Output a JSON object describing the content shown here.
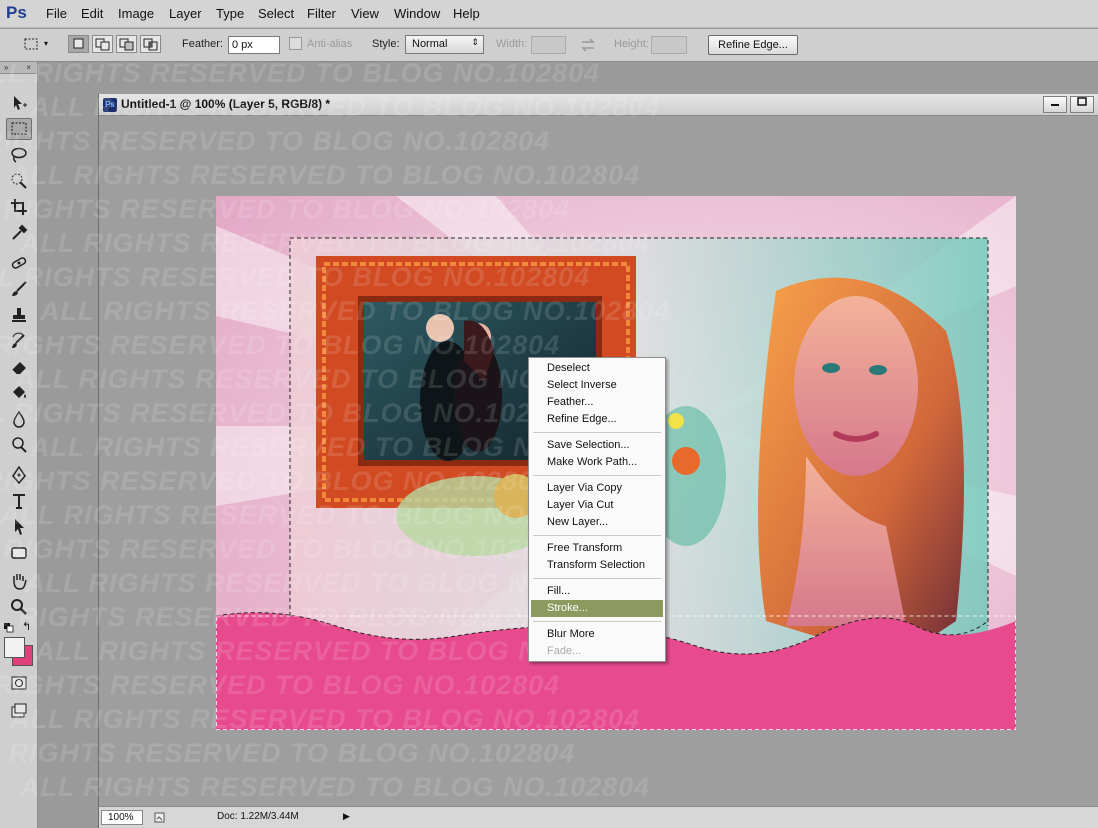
{
  "app": {
    "logo": "Ps"
  },
  "menubar": {
    "items": [
      "File",
      "Edit",
      "Image",
      "Layer",
      "Type",
      "Select",
      "Filter",
      "View",
      "Window",
      "Help"
    ]
  },
  "options": {
    "feather_label": "Feather:",
    "feather_value": "0 px",
    "antialias_label": "Anti-alias",
    "style_label": "Style:",
    "style_value": "Normal",
    "width_label": "Width:",
    "height_label": "Height:",
    "refine_edge_label": "Refine Edge..."
  },
  "toolbox": {
    "collapse": "»",
    "close": "×",
    "tools": [
      "move-tool",
      "rectangular-marquee-tool",
      "lasso-tool",
      "quick-selection-tool",
      "crop-tool",
      "eyedropper-tool",
      "spot-healing-tool",
      "brush-tool",
      "clone-stamp-tool",
      "history-brush-tool",
      "eraser-tool",
      "paint-bucket-tool",
      "blur-tool",
      "dodge-tool",
      "pen-tool",
      "type-tool",
      "path-selection-tool",
      "rectangle-tool",
      "hand-tool",
      "zoom-tool"
    ]
  },
  "document": {
    "icon": "Ps",
    "title": "Untitled-1 @ 100% (Layer 5, RGB/8) *",
    "zoom": "100%",
    "doc_size": "Doc: 1.22M/3.44M"
  },
  "context_menu": {
    "items": [
      {
        "label": "Deselect",
        "state": "normal"
      },
      {
        "label": "Select Inverse",
        "state": "normal"
      },
      {
        "label": "Feather...",
        "state": "normal"
      },
      {
        "label": "Refine Edge...",
        "state": "normal"
      },
      {
        "label": "Save Selection...",
        "state": "normal"
      },
      {
        "label": "Make Work Path...",
        "state": "normal"
      },
      {
        "label": "Layer Via Copy",
        "state": "normal"
      },
      {
        "label": "Layer Via Cut",
        "state": "normal"
      },
      {
        "label": "New Layer...",
        "state": "normal"
      },
      {
        "label": "Free Transform",
        "state": "normal"
      },
      {
        "label": "Transform Selection",
        "state": "normal"
      },
      {
        "label": "Fill...",
        "state": "normal"
      },
      {
        "label": "Stroke...",
        "state": "highlighted"
      },
      {
        "label": "Blur More",
        "state": "normal"
      },
      {
        "label": "Fade...",
        "state": "disabled"
      }
    ]
  },
  "watermark": {
    "text": "ALL RIGHTS RESERVED TO BLOG NO.102804"
  },
  "colors": {
    "foreground": "#f2f2f2",
    "background": "#e0407a",
    "highlight": "#8c9a60",
    "pink": "#e84a8e",
    "frame": "#d24a22"
  }
}
